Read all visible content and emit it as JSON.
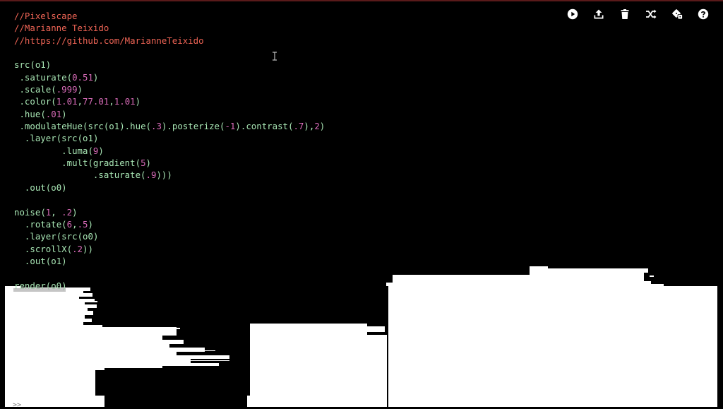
{
  "editor": {
    "lines": [
      [
        [
          "cmt",
          "//Pixelscape"
        ]
      ],
      [
        [
          "cmt",
          "//Marianne Teixido"
        ]
      ],
      [
        [
          "cmt",
          "//https://github.com/MarianneTeixido"
        ]
      ],
      [],
      [
        [
          "fn",
          "src"
        ],
        [
          "p",
          "(o1)"
        ]
      ],
      [
        [
          "p",
          " ."
        ],
        [
          "fn",
          "saturate"
        ],
        [
          "p",
          "("
        ],
        [
          "num",
          "0.51"
        ],
        [
          "p",
          ")"
        ]
      ],
      [
        [
          "p",
          " ."
        ],
        [
          "fn",
          "scale"
        ],
        [
          "p",
          "("
        ],
        [
          "num",
          ".999"
        ],
        [
          "p",
          ")"
        ]
      ],
      [
        [
          "p",
          " ."
        ],
        [
          "fn",
          "color"
        ],
        [
          "p",
          "("
        ],
        [
          "num",
          "1.01"
        ],
        [
          "p",
          ","
        ],
        [
          "num",
          "77.01"
        ],
        [
          "p",
          ","
        ],
        [
          "num",
          "1.01"
        ],
        [
          "p",
          ")"
        ]
      ],
      [
        [
          "p",
          " ."
        ],
        [
          "fn",
          "hue"
        ],
        [
          "p",
          "("
        ],
        [
          "num",
          ".01"
        ],
        [
          "p",
          ")"
        ]
      ],
      [
        [
          "p",
          " ."
        ],
        [
          "fn",
          "modulateHue"
        ],
        [
          "p",
          "("
        ],
        [
          "fn",
          "src"
        ],
        [
          "p",
          "(o1)."
        ],
        [
          "fn",
          "hue"
        ],
        [
          "p",
          "("
        ],
        [
          "num",
          ".3"
        ],
        [
          "p",
          ")."
        ],
        [
          "fn",
          "posterize"
        ],
        [
          "p",
          "("
        ],
        [
          "num",
          "-1"
        ],
        [
          "p",
          ")."
        ],
        [
          "fn",
          "contrast"
        ],
        [
          "p",
          "("
        ],
        [
          "num",
          ".7"
        ],
        [
          "p",
          "),"
        ],
        [
          "num",
          "2"
        ],
        [
          "p",
          ")"
        ]
      ],
      [
        [
          "p",
          "  ."
        ],
        [
          "fn",
          "layer"
        ],
        [
          "p",
          "("
        ],
        [
          "fn",
          "src"
        ],
        [
          "p",
          "(o1)"
        ]
      ],
      [
        [
          "p",
          "         ."
        ],
        [
          "fn",
          "luma"
        ],
        [
          "p",
          "("
        ],
        [
          "num",
          "9"
        ],
        [
          "p",
          ")"
        ]
      ],
      [
        [
          "p",
          "         ."
        ],
        [
          "fn",
          "mult"
        ],
        [
          "p",
          "("
        ],
        [
          "fn",
          "gradient"
        ],
        [
          "p",
          "("
        ],
        [
          "num",
          "5"
        ],
        [
          "p",
          ")"
        ]
      ],
      [
        [
          "p",
          "               ."
        ],
        [
          "fn",
          "saturate"
        ],
        [
          "p",
          "("
        ],
        [
          "num",
          ".9"
        ],
        [
          "p",
          ")))"
        ]
      ],
      [
        [
          "p",
          "  ."
        ],
        [
          "fn",
          "out"
        ],
        [
          "p",
          "(o0)"
        ]
      ],
      [],
      [
        [
          "fn",
          "noise"
        ],
        [
          "p",
          "("
        ],
        [
          "num",
          "1"
        ],
        [
          "p",
          ", "
        ],
        [
          "num",
          ".2"
        ],
        [
          "p",
          ")"
        ]
      ],
      [
        [
          "p",
          "  ."
        ],
        [
          "fn",
          "rotate"
        ],
        [
          "p",
          "("
        ],
        [
          "num",
          "6"
        ],
        [
          "p",
          ","
        ],
        [
          "num",
          ".5"
        ],
        [
          "p",
          ")"
        ]
      ],
      [
        [
          "p",
          "  ."
        ],
        [
          "fn",
          "layer"
        ],
        [
          "p",
          "("
        ],
        [
          "fn",
          "src"
        ],
        [
          "p",
          "(o0)"
        ]
      ],
      [
        [
          "p",
          "  ."
        ],
        [
          "fn",
          "scrollX"
        ],
        [
          "p",
          "("
        ],
        [
          "num",
          ".2"
        ],
        [
          "p",
          "))"
        ]
      ],
      [
        [
          "p",
          "  ."
        ],
        [
          "fn",
          "out"
        ],
        [
          "p",
          "(o1)"
        ]
      ],
      [],
      [
        [
          "fn",
          "render"
        ],
        [
          "p",
          "(o0)"
        ]
      ]
    ]
  },
  "toolbar": [
    {
      "name": "run-button",
      "icon": "play-icon"
    },
    {
      "name": "upload-button",
      "icon": "upload-icon"
    },
    {
      "name": "clear-button",
      "icon": "trash-icon"
    },
    {
      "name": "shuffle-button",
      "icon": "shuffle-icon"
    },
    {
      "name": "random-sketch-button",
      "icon": "dice-icon"
    },
    {
      "name": "help-button",
      "icon": "help-icon"
    }
  ],
  "console": {
    "prompt": ">>"
  },
  "colors": {
    "comment": "#ee6455",
    "function": "#a8e6b4",
    "number": "#d86bb8",
    "background": "#000000",
    "visual": "#ffffff"
  }
}
